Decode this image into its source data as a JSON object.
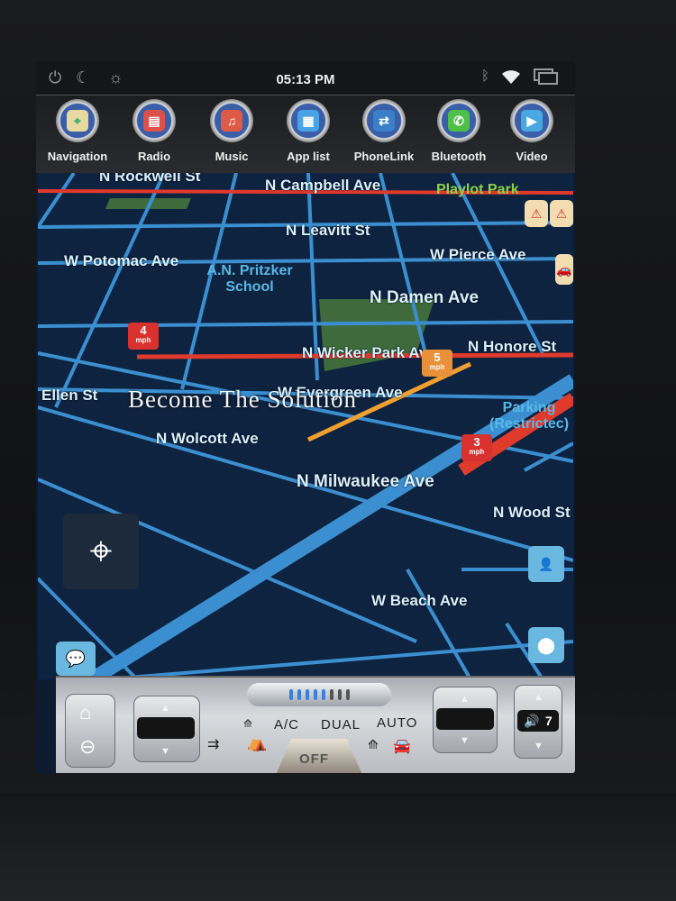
{
  "status_bar": {
    "time": "05:13 PM",
    "left_icons": [
      "power-icon",
      "night-mode-icon",
      "brightness-icon"
    ],
    "right_icons": [
      "bluetooth-icon",
      "wifi-icon",
      "recent-apps-icon"
    ]
  },
  "dock": {
    "apps": [
      {
        "label": "Navigation",
        "icon": "navigation-icon",
        "color": "#e8d9a0"
      },
      {
        "label": "Radio",
        "icon": "radio-icon",
        "color": "#e0504a"
      },
      {
        "label": "Music",
        "icon": "music-icon",
        "color": "#e05a48"
      },
      {
        "label": "App list",
        "icon": "app-list-icon",
        "color": "#4aa3e6"
      },
      {
        "label": "PhoneLink",
        "icon": "phonelink-icon",
        "color": "#3a7fc8"
      },
      {
        "label": "Bluetooth",
        "icon": "phone-icon",
        "color": "#4ec04a"
      },
      {
        "label": "Video",
        "icon": "video-icon",
        "color": "#4aa8e0"
      }
    ]
  },
  "map": {
    "streets": {
      "rockwell": "N Rockwell St",
      "campbell": "N Campbell Ave",
      "leavitt": "N Leavitt St",
      "pierce": "W Pierce Ave",
      "potomac": "W Potomac Ave",
      "damen": "N Damen Ave",
      "wicker": "N Wicker Park Ave",
      "honore": "N Honore St",
      "ellen": "Ellen St",
      "evergreen": "W Evergreen Ave",
      "wolcott": "N Wolcott Ave",
      "milwaukee": "N Milwaukee Ave",
      "wood": "N Wood St",
      "beach": "W Beach Ave"
    },
    "pois": {
      "school": "A.N. Pritzker School",
      "park": "Playlot Park",
      "parking": "Parking (Restrictec)"
    },
    "speed_markers": [
      {
        "value": "4",
        "unit": "mph",
        "color": "#d9322e"
      },
      {
        "value": "5",
        "unit": "mph",
        "color": "#e8913a"
      },
      {
        "value": "3",
        "unit": "mph",
        "color": "#d9322e"
      }
    ],
    "watermark": "Become The Solution",
    "colors": {
      "background": "#0e2340",
      "road": "#3b8fd0",
      "traffic_heavy": "#e03a2c",
      "traffic_moderate": "#f0a030",
      "park": "#3f6b3c"
    }
  },
  "climate": {
    "ac_label": "A/C",
    "dual_label": "DUAL",
    "auto_label": "AUTO",
    "off_label": "OFF",
    "fan_level": 5,
    "fan_max": 8,
    "volume": "7"
  }
}
